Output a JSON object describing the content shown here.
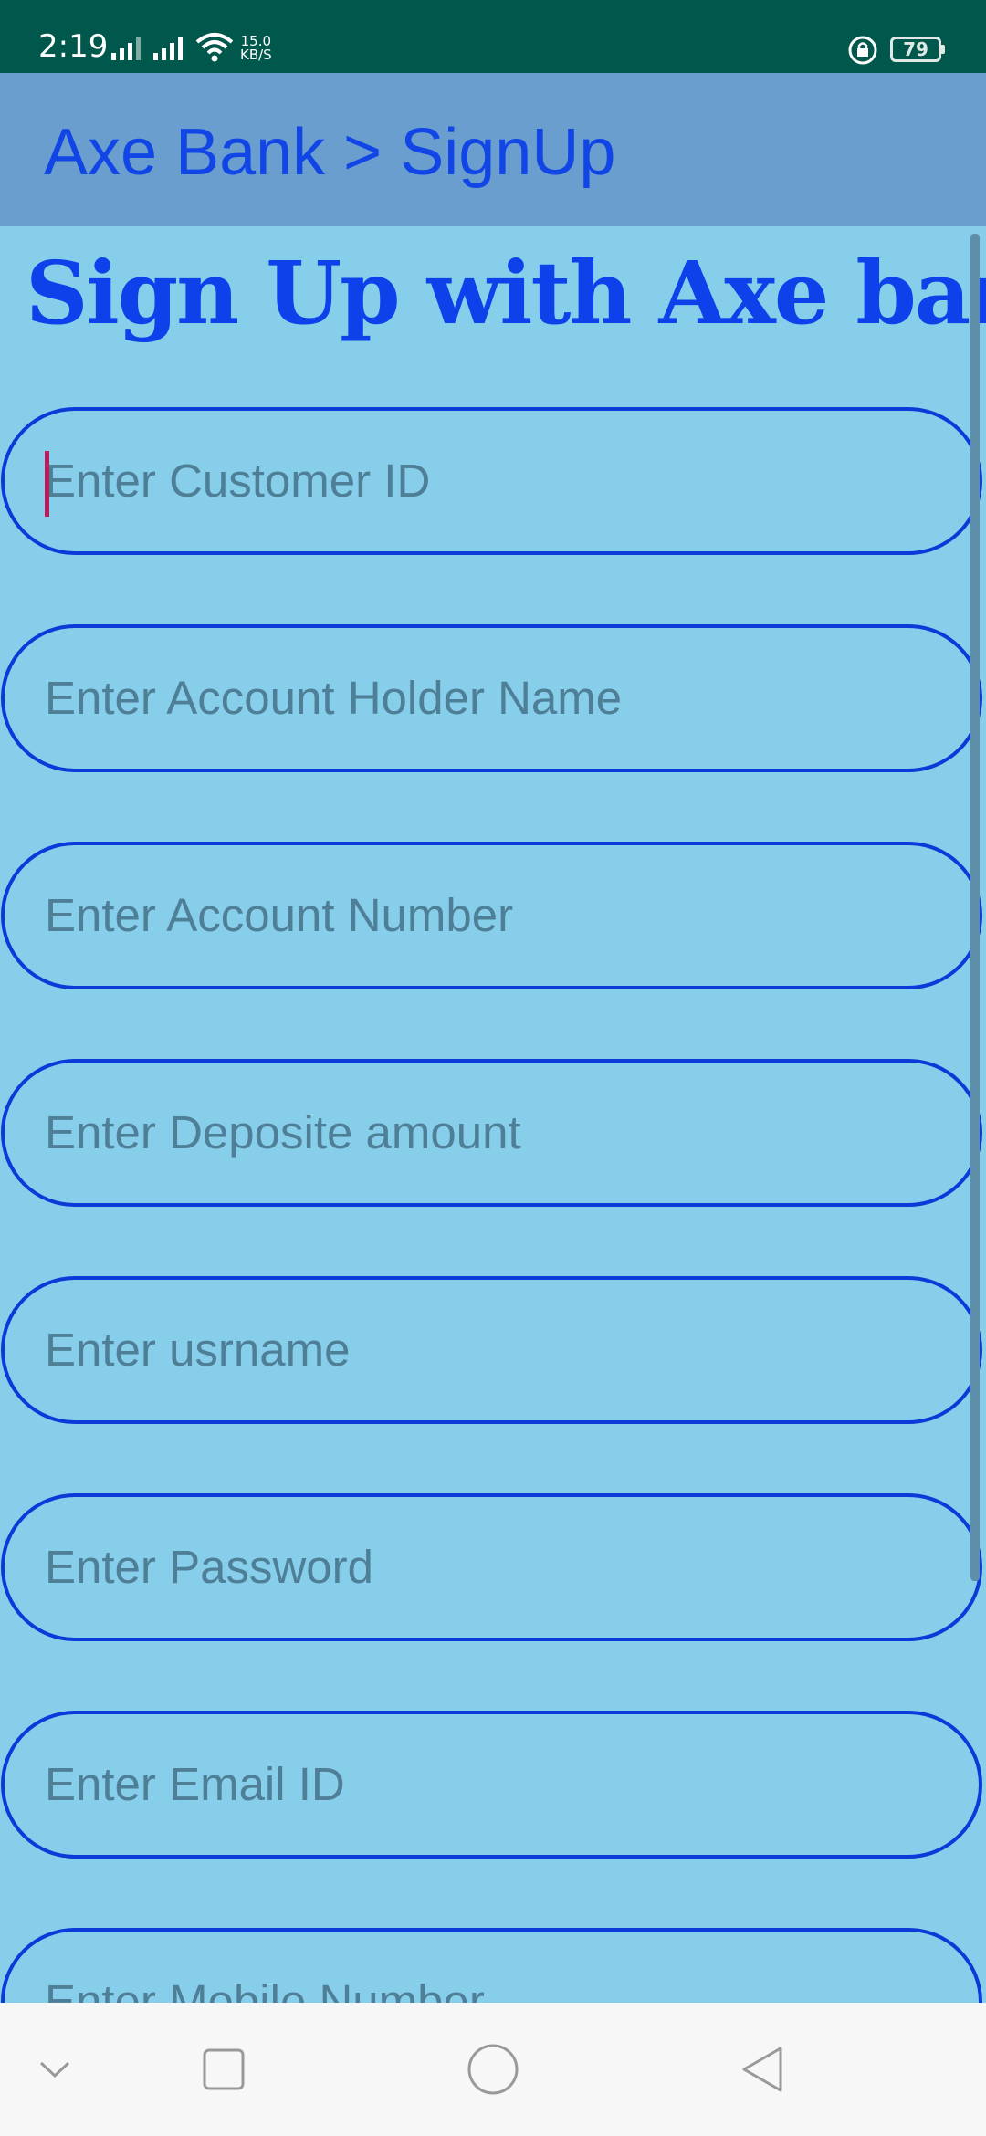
{
  "status_bar": {
    "time": "2:19",
    "net_speed_value": "15.0",
    "net_speed_unit": "KB/S",
    "battery_level": "79"
  },
  "app_bar": {
    "title": "Axe Bank > SignUp"
  },
  "form": {
    "heading": "Sign Up with Axe bank",
    "fields": [
      {
        "placeholder": "Enter Customer ID",
        "value": "",
        "focused": true
      },
      {
        "placeholder": "Enter Account Holder Name",
        "value": ""
      },
      {
        "placeholder": "Enter Account Number",
        "value": ""
      },
      {
        "placeholder": "Enter Deposite amount",
        "value": ""
      },
      {
        "placeholder": "Enter usrname",
        "value": ""
      },
      {
        "placeholder": "Enter Password",
        "value": ""
      },
      {
        "placeholder": "Enter Email ID",
        "value": ""
      },
      {
        "placeholder": "Enter Mobile Number",
        "value": ""
      }
    ]
  },
  "nav_bar": {
    "icons": [
      "chevron-down-icon",
      "recents-square-icon",
      "home-circle-icon",
      "back-triangle-icon"
    ]
  },
  "colors": {
    "status_bar": "#00574b",
    "app_bar": "#6a9ecf",
    "background": "#87ceeb",
    "accent_blue": "#0f41ea",
    "placeholder": "#4f7f97",
    "cursor": "#c2185b"
  }
}
